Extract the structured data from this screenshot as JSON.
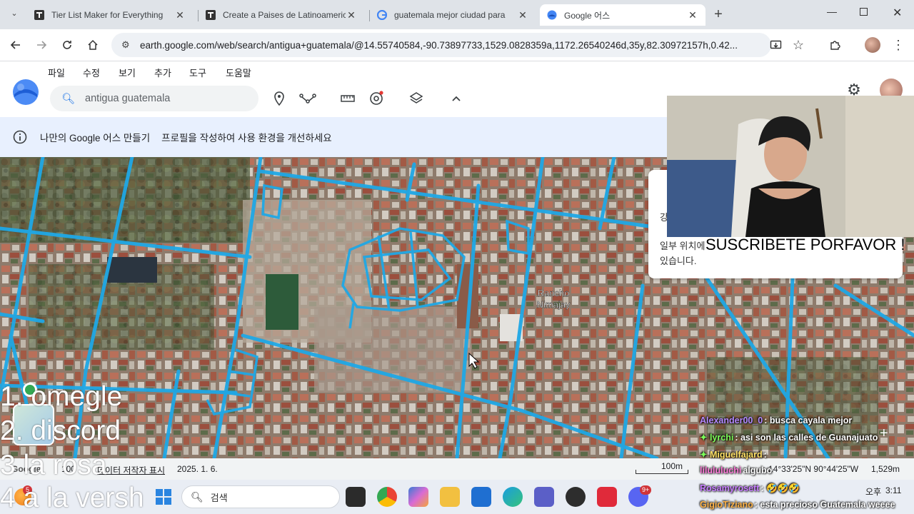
{
  "browser": {
    "tabs": [
      {
        "title": "Tier List Maker for Everything",
        "favicon": "tiermaker-icon",
        "active": false
      },
      {
        "title": "Create a Paises de Latinoamerica",
        "favicon": "tiermaker-icon",
        "active": false
      },
      {
        "title": "guatemala mejor ciudad para",
        "favicon": "google-icon",
        "active": false
      },
      {
        "title": "Google 어스",
        "favicon": "google-earth-icon",
        "active": true
      }
    ],
    "new_tab": "+",
    "url": "earth.google.com/web/search/antigua+guatemala/@14.55740584,-90.73897733,1529.0828359a,1172.26540246d,35y,82.30972157h,0.42..."
  },
  "earth": {
    "menu": [
      "파일",
      "수정",
      "보기",
      "추가",
      "도구",
      "도움말"
    ],
    "search": {
      "value": "antigua guatemala"
    },
    "banner": {
      "link": "나만의 Google 어스 만들기",
      "text": "프로필을 작성하여 사용 환경을 개선하세요"
    },
    "popup_text": [
      "강",
      "일부 위치에",
      "있습니다."
    ],
    "place_label": [
      "Rancho",
      "Nimajay"
    ],
    "status": {
      "google": "Google",
      "zoom": "100",
      "attribution": "데이터 저작자 표시",
      "date": "2025. 1. 6.",
      "scale": "100m",
      "coords": "14°33'25\"N 90°44'25\"W",
      "altitude": "1,529m"
    }
  },
  "overlay": {
    "subscribe": "SUSCRIBETE PORFAVOR !",
    "list": [
      "1. omegle",
      "2. discord",
      "3 la rosa",
      "4 a la versh"
    ]
  },
  "chat": [
    {
      "user": "Alexander00_0",
      "message": ": busca cayala mejor",
      "color": "#b388ff"
    },
    {
      "user": "lyrchi",
      "message": ": asi son las calles de Guanajuato",
      "color": "#7cff5a"
    },
    {
      "user": "Miguelfajard",
      "message": ":",
      "color": "#ffe066"
    },
    {
      "user": "lilululuchi",
      "message": "algubo",
      "color": "#ff7ad9"
    },
    {
      "user": "Rosamyrosett",
      "message": ": 🤣🤣🤣",
      "color": "#c77dff"
    },
    {
      "user": "GigioTiziano",
      "message": ": esta precioso Guatemala weeee",
      "color": "#ffb347"
    }
  ],
  "taskbar": {
    "search": "검색",
    "notification_badge": "5",
    "discord_badge": "9+",
    "time_period": "오후",
    "time": "3:11"
  }
}
